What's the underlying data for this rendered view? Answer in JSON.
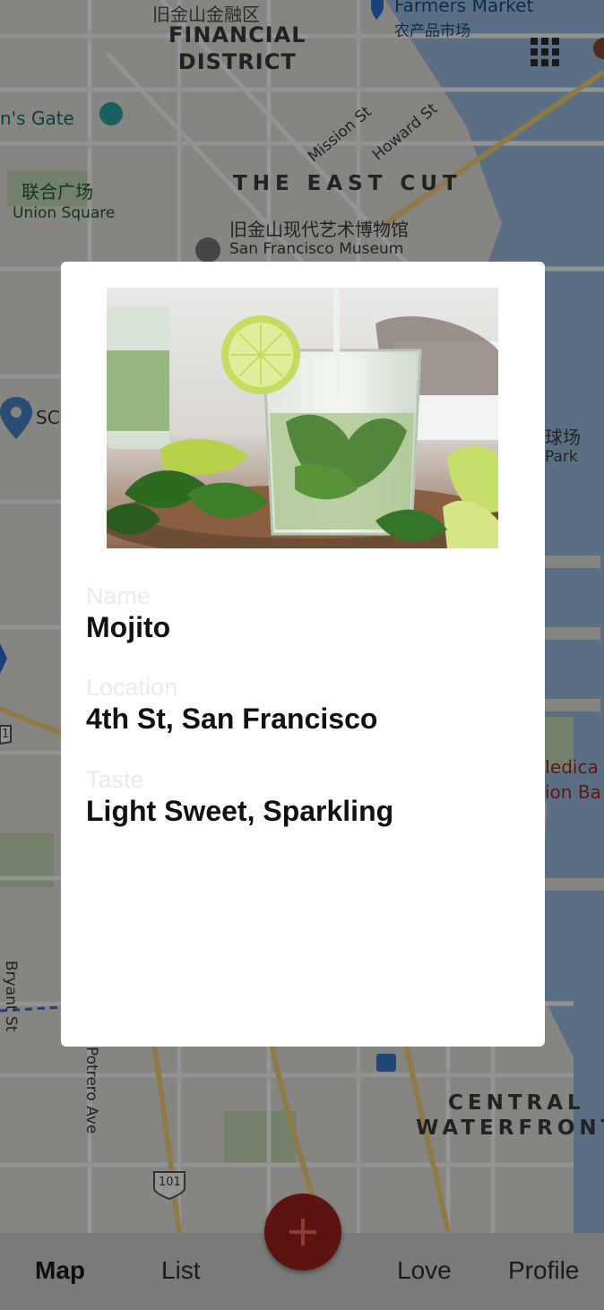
{
  "map": {
    "labels": {
      "top_chinese_partial": "旧金山金融区",
      "financial_district_line1": "FINANCIAL",
      "financial_district_line2": "DISTRICT",
      "farmers_market": "Farmers Market",
      "farmers_market_chinese": "农产品市场",
      "golden_gate_partial": "n's Gate",
      "mission_st": "Mission St",
      "howard_st": "Howard St",
      "union_square_chinese": "联合广场",
      "union_square": "Union Square",
      "east_cut": "THE EAST CUT",
      "sfmoma_chinese": "旧金山现代艺术博物馆",
      "sfmoma": "San Francisco Museum",
      "sc_partial": "SC",
      "park_chinese_partial": "球场",
      "park_partial": "Park",
      "medical_partial1": "Iedica",
      "medical_partial2": "ion Ba",
      "bryant_st": "Bryant St",
      "potrero_ave": "Potrero Ave",
      "central_line1": "CENTRAL",
      "central_line2": "WATERFRONT",
      "route_101": "101",
      "route_1_partial": "1"
    },
    "grid_icon": "grid-menu-icon",
    "colors": {
      "land": "#e8e6e1",
      "water": "#9cc0e3",
      "park": "#c7dfb8",
      "highway": "#f5d37a"
    }
  },
  "modal": {
    "image_alt_icon": "mojito-photo",
    "fields": [
      {
        "label": "Name",
        "value": "Mojito"
      },
      {
        "label": "Location",
        "value": "4th St, San Francisco"
      },
      {
        "label": "Taste",
        "value": "Light Sweet, Sparkling"
      }
    ]
  },
  "fab": {
    "symbol": "+",
    "icon": "plus-icon"
  },
  "nav": {
    "items": [
      {
        "label": "Map",
        "active": true
      },
      {
        "label": "List",
        "active": false
      },
      {
        "label": "Love",
        "active": false
      },
      {
        "label": "Profile",
        "active": false
      }
    ]
  }
}
